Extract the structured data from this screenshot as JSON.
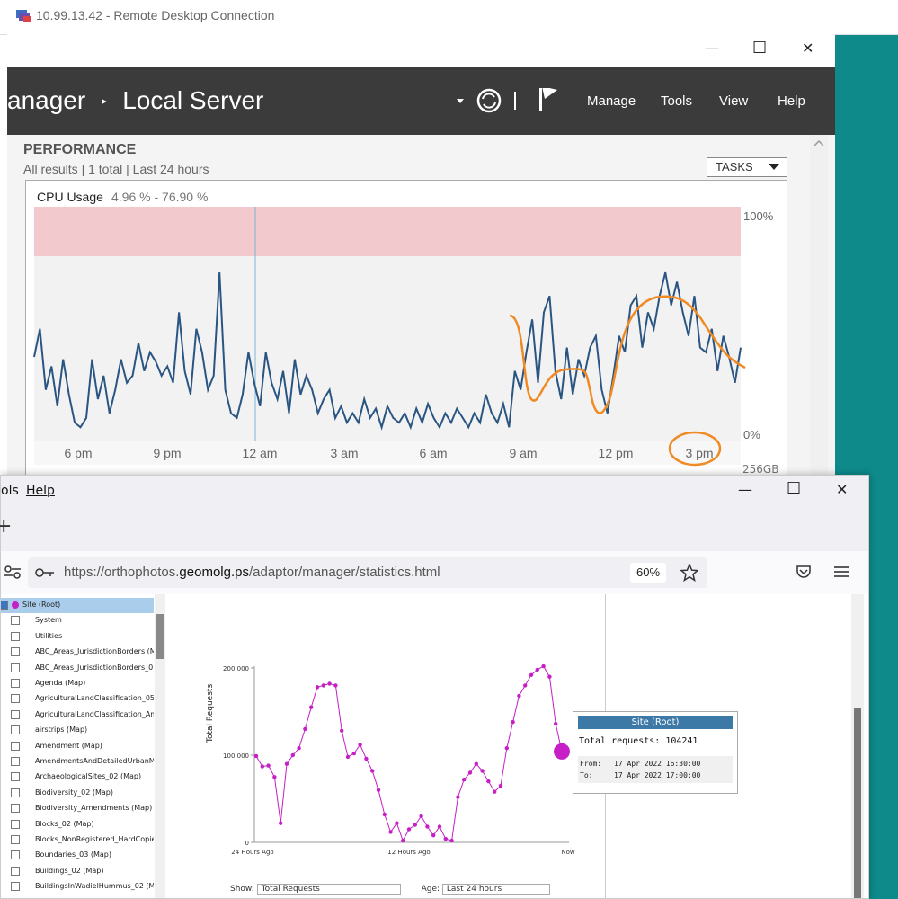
{
  "rdc": {
    "title": "10.99.13.42 - Remote Desktop Connection",
    "minimize": "—",
    "maximize": "☐",
    "close": "✕"
  },
  "server_manager": {
    "title_part1": "anager",
    "title_sep": "‣",
    "title_part2": "Local Server",
    "menu": [
      "Manage",
      "Tools",
      "View",
      "Help"
    ],
    "performance": {
      "heading": "PERFORMANCE",
      "subtitle": "All results | 1 total  |  Last 24 hours",
      "tasks_label": "TASKS",
      "cpu_label": "CPU Usage",
      "cpu_range": "4.96 % - 76.90 %",
      "y_top": "100%",
      "y_bottom": "0%",
      "x_ticks": [
        "6 pm",
        "9 pm",
        "12 am",
        "3 am",
        "6 am",
        "9 am",
        "12 pm",
        "3 pm"
      ],
      "mem_label": "256GB"
    }
  },
  "firefox": {
    "menu": [
      "ols",
      "Help"
    ],
    "url_prefix": "https://orthophotos.",
    "url_host": "geomolg.ps",
    "url_suffix": "/adaptor/manager/statistics.html",
    "zoom": "60%",
    "new_tab": "+"
  },
  "tree": [
    {
      "label": "Site (Root)",
      "selected": true,
      "checked": true
    },
    {
      "label": "System"
    },
    {
      "label": "Utilities"
    },
    {
      "label": "ABC_Areas_JurisdictionBorders (M"
    },
    {
      "label": "ABC_Areas_JurisdictionBorders_0"
    },
    {
      "label": "Agenda (Map)"
    },
    {
      "label": "AgriculturalLandClassification_05"
    },
    {
      "label": "AgriculturalLandClassification_Am"
    },
    {
      "label": "airstrips (Map)"
    },
    {
      "label": "Amendment (Map)"
    },
    {
      "label": "AmendmentsAndDetailedUrbanM"
    },
    {
      "label": "ArchaeologicalSites_02 (Map)"
    },
    {
      "label": "Biodiversity_02 (Map)"
    },
    {
      "label": "Biodiversity_Amendments (Map)"
    },
    {
      "label": "Blocks_02 (Map)"
    },
    {
      "label": "Blocks_NonRegistered_HardCopie"
    },
    {
      "label": "Boundaries_03 (Map)"
    },
    {
      "label": "Buildings_02 (Map)"
    },
    {
      "label": "BuildingsInWadielHummus_02 (M"
    }
  ],
  "requests_chart": {
    "ylabel": "Total Requests",
    "y_ticks": [
      "200,000",
      "100,000",
      "0"
    ],
    "x_ticks": [
      "24 Hours Ago",
      "12 Hours Ago",
      "Now"
    ],
    "show_label": "Show:",
    "show_value": "Total Requests",
    "age_label": "Age:",
    "age_value": "Last 24 hours"
  },
  "tooltip": {
    "title": "Site (Root)",
    "total": "Total requests: 104241",
    "from_label": "From:",
    "from_value": "17 Apr 2022 16:30:00",
    "to_label": "To:",
    "to_value": "17 Apr 2022 17:00:00"
  },
  "chart_data": [
    {
      "type": "line",
      "title": "CPU Usage",
      "subtitle": "4.96 % - 76.90 %",
      "x_ticks": [
        "6 pm",
        "9 pm",
        "12 am",
        "3 am",
        "6 am",
        "9 am",
        "12 pm",
        "3 pm"
      ],
      "ylim": [
        0,
        100
      ],
      "series": [
        {
          "values": [
            36,
            48,
            22,
            32,
            15,
            35,
            20,
            8,
            6,
            10,
            35,
            18,
            28,
            12,
            22,
            35,
            25,
            28,
            42,
            30,
            38,
            34,
            28,
            32,
            25,
            55,
            30,
            20,
            48,
            38,
            22,
            28,
            72,
            22,
            12,
            10,
            20,
            38,
            25,
            15,
            38,
            25,
            18,
            30,
            12,
            35,
            20,
            28,
            22,
            12,
            18,
            22,
            10,
            15,
            8,
            12,
            8,
            18,
            10,
            14,
            6,
            15,
            10,
            8,
            12,
            6,
            14,
            8,
            16,
            10,
            6,
            12,
            8,
            14,
            10,
            6,
            12,
            8,
            20,
            12,
            8,
            16,
            6,
            30,
            22,
            38,
            52,
            25,
            55,
            62,
            30,
            18,
            40,
            20,
            35,
            28,
            40,
            45,
            22,
            12,
            28,
            45,
            38,
            58,
            62,
            40,
            55,
            48,
            62,
            72,
            58,
            68,
            55,
            45,
            62,
            40,
            38,
            48,
            30,
            45,
            36,
            25,
            40
          ]
        }
      ]
    },
    {
      "type": "line",
      "ylabel": "Total Requests",
      "ylim": [
        0,
        200000
      ],
      "x_ticks": [
        "24 Hours Ago",
        "12 Hours Ago",
        "Now"
      ],
      "series": [
        {
          "name": "Site (Root)",
          "values": [
            99000,
            87000,
            88000,
            75000,
            22000,
            90000,
            100000,
            108000,
            130000,
            155000,
            178000,
            180000,
            182000,
            180000,
            128000,
            98000,
            102000,
            112000,
            96000,
            82000,
            60000,
            32000,
            12000,
            22000,
            2000,
            15000,
            20000,
            30000,
            18000,
            8000,
            18000,
            4000,
            2000,
            52000,
            72000,
            80000,
            90000,
            82000,
            70000,
            58000,
            65000,
            108000,
            138000,
            168000,
            180000,
            192000,
            198000,
            202000,
            190000,
            136000,
            104241
          ]
        }
      ]
    }
  ]
}
